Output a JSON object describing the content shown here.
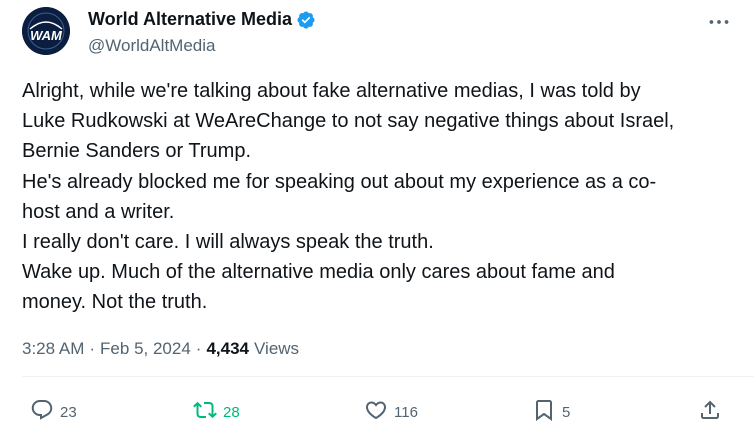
{
  "author": {
    "display_name": "World Alternative Media",
    "handle": "@WorldAltMedia",
    "avatar_text": "WAM",
    "verified": true,
    "verified_color": "#1d9bf0"
  },
  "tweet": {
    "lines": [
      "Alright, while we're talking about fake alternative medias, I was told by",
      "Luke Rudkowski at WeAreChange to not say negative things about Israel,",
      "Bernie Sanders or Trump.",
      "He's already blocked me for speaking out about my experience as a co-",
      "host and a writer.",
      "I really don't care. I will always speak the truth.",
      "Wake up. Much of the alternative media only cares about fame and",
      "money. Not the truth."
    ]
  },
  "meta": {
    "time": "3:28 AM",
    "date": "Feb 5, 2024",
    "views_count": "4,434",
    "views_label": "Views",
    "separator": "·"
  },
  "actions": {
    "replies": "23",
    "retweets": "28",
    "likes": "116",
    "bookmarks": "5"
  },
  "icons": {
    "reply": "reply-icon",
    "retweet": "retweet-icon",
    "like": "heart-icon",
    "bookmark": "bookmark-icon",
    "share": "share-icon",
    "more": "more-icon"
  },
  "colors": {
    "text": "#0f1419",
    "secondary": "#536471",
    "retweet_active": "#00ba7c",
    "brand_blue": "#1d9bf0"
  }
}
